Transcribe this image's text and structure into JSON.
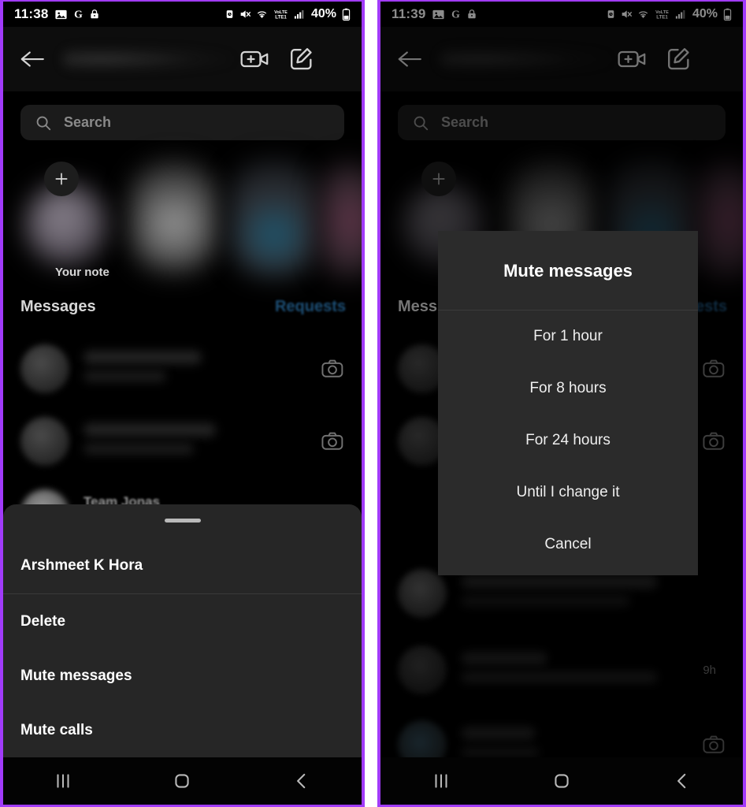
{
  "panels": [
    {
      "id": "left",
      "status_bar": {
        "clock": "11:38",
        "battery_percent": "40%",
        "left_icons": [
          "image-icon",
          "google-icon",
          "lock-icon"
        ],
        "right_icons": [
          "alarm-icon",
          "mute-icon",
          "wifi-icon",
          "volte-lte-icon",
          "signal-icon",
          "battery-icon"
        ],
        "network_label": "VoLTE1"
      },
      "header": {
        "back_label": "Back",
        "title_redacted": "",
        "video_call_label": "New video call",
        "compose_label": "New message"
      },
      "search": {
        "placeholder": "Search"
      },
      "notes": {
        "your_note_label": "Your note",
        "add_note_label": "+"
      },
      "sections": {
        "messages_label": "Messages",
        "requests_label": "Requests"
      },
      "conversations": [
        {
          "name": "",
          "preview": "",
          "time": "",
          "trailing_icon": "camera-icon"
        },
        {
          "name": "",
          "preview": "",
          "time": "",
          "trailing_icon": "camera-icon"
        },
        {
          "name": "Team Jonas",
          "preview": "",
          "time": "",
          "trailing_icon": "camera-icon"
        }
      ],
      "bottom_sheet": {
        "title": "Arshmeet K Hora",
        "items": [
          {
            "label": "Delete"
          },
          {
            "label": "Mute messages"
          },
          {
            "label": "Mute calls"
          }
        ]
      },
      "nav_bar": {
        "recents_label": "Recents",
        "home_label": "Home",
        "back_label": "Back"
      }
    },
    {
      "id": "right",
      "status_bar": {
        "clock": "11:39",
        "battery_percent": "40%",
        "left_icons": [
          "image-icon",
          "google-icon",
          "lock-icon"
        ],
        "right_icons": [
          "alarm-icon",
          "mute-icon",
          "wifi-icon",
          "volte-lte-icon",
          "signal-icon",
          "battery-icon"
        ],
        "network_label": "VoLTE1"
      },
      "header": {
        "back_label": "Back",
        "title_redacted": "",
        "video_call_label": "New video call",
        "compose_label": "New message"
      },
      "search": {
        "placeholder": "Search"
      },
      "notes": {
        "your_note_label": "",
        "add_note_label": "+"
      },
      "sections": {
        "messages_label": "Mess",
        "requests_label": "uests"
      },
      "conversations": [
        {
          "name": "",
          "preview": "",
          "time": "",
          "trailing_icon": "camera-icon"
        },
        {
          "name": "",
          "preview": "",
          "time": "",
          "trailing_icon": "camera-icon"
        },
        {
          "name": "",
          "preview": "",
          "time": "",
          "trailing_icon": ""
        },
        {
          "name": "",
          "preview": "",
          "time": "9h",
          "trailing_icon": ""
        },
        {
          "name": "",
          "preview": "",
          "time": "",
          "trailing_icon": "camera-icon"
        }
      ],
      "dialog": {
        "title": "Mute messages",
        "options": [
          {
            "label": "For 1 hour"
          },
          {
            "label": "For 8 hours"
          },
          {
            "label": "For 24 hours"
          },
          {
            "label": "Until I change it"
          },
          {
            "label": "Cancel"
          }
        ]
      },
      "nav_bar": {
        "recents_label": "Recents",
        "home_label": "Home",
        "back_label": "Back"
      }
    }
  ],
  "theme": {
    "frame_border": "#a13bfa",
    "screen_bg": "#000000",
    "sheet_bg": "#262626",
    "dialog_bg": "#2b2b2b",
    "search_bg": "#1b1b1b",
    "text_primary": "#ffffff",
    "text_secondary": "#8a8a8a",
    "requests_blue": "#1d4f76"
  }
}
